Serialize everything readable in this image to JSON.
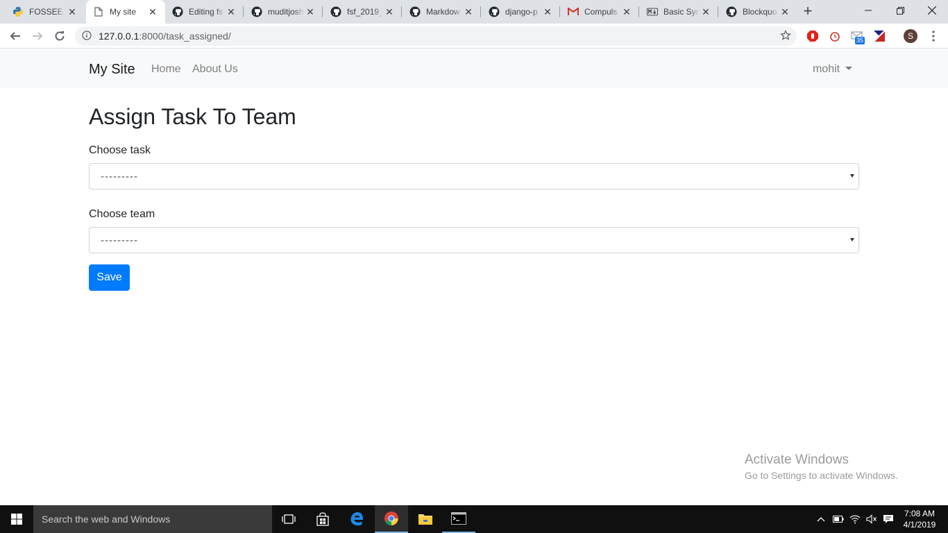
{
  "browser": {
    "tabs": [
      {
        "title": "FOSSEE S",
        "icon": "python-icon",
        "active": false
      },
      {
        "title": "My site",
        "icon": "page-icon",
        "active": true
      },
      {
        "title": "Editing fs",
        "icon": "github-icon",
        "active": false
      },
      {
        "title": "muditjosh",
        "icon": "github-icon",
        "active": false
      },
      {
        "title": "fsf_2019_",
        "icon": "github-icon",
        "active": false
      },
      {
        "title": "Markdow",
        "icon": "github-icon",
        "active": false
      },
      {
        "title": "django-p",
        "icon": "github-icon",
        "active": false
      },
      {
        "title": "Compuls",
        "icon": "gmail-icon",
        "active": false
      },
      {
        "title": "Basic Syn",
        "icon": "markdown-icon",
        "active": false
      },
      {
        "title": "Blockquo",
        "icon": "github-icon",
        "active": false
      }
    ],
    "url_host": "127.0.0.1",
    "url_path": ":8000/task_assigned/",
    "ext_badge": "35",
    "profile_initial": "S"
  },
  "site": {
    "brand": "My Site",
    "nav_home": "Home",
    "nav_about": "About Us",
    "user": "mohit"
  },
  "form": {
    "title": "Assign Task To Team",
    "task_label": "Choose task",
    "task_value": "---------",
    "team_label": "Choose team",
    "team_value": "---------",
    "save_label": "Save"
  },
  "watermark": {
    "title": "Activate Windows",
    "subtitle": "Go to Settings to activate Windows."
  },
  "taskbar": {
    "search_placeholder": "Search the web and Windows",
    "time": "7:08 AM",
    "date": "4/1/2019"
  },
  "colors": {
    "primary": "#007bff",
    "navbar_bg": "#f8f9fa",
    "tabstrip_bg": "#dee1e6",
    "taskbar_bg": "#101010"
  }
}
